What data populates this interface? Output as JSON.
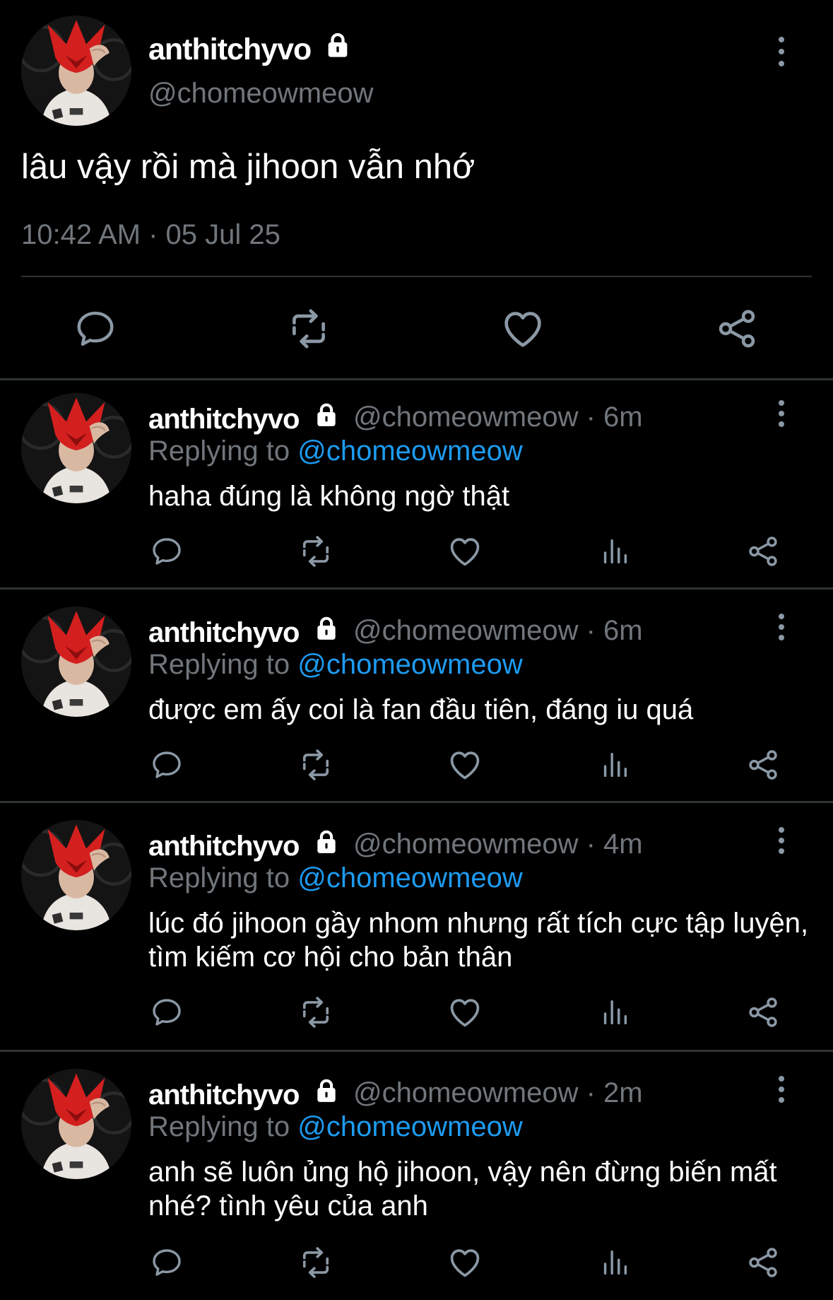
{
  "main_tweet": {
    "display_name": "anthitchyvo",
    "handle": "@chomeowmeow",
    "text": "lâu vậy rồi mà jihoon vẫn nhớ",
    "timestamp": "10:42 AM · 05 Jul 25",
    "actions": [
      "reply-icon",
      "retweet-icon",
      "like-icon",
      "share-icon"
    ]
  },
  "replies": [
    {
      "display_name": "anthitchyvo",
      "meta": "@chomeowmeow · 6m",
      "replying_prefix": "Replying to ",
      "replying_to": "@chomeowmeow",
      "text": "haha đúng là không ngờ thật"
    },
    {
      "display_name": "anthitchyvo",
      "meta": "@chomeowmeow · 6m",
      "replying_prefix": "Replying to ",
      "replying_to": "@chomeowmeow",
      "text": "được em ấy coi là fan đầu tiên, đáng iu quá"
    },
    {
      "display_name": "anthitchyvo",
      "meta": "@chomeowmeow · 4m",
      "replying_prefix": "Replying to ",
      "replying_to": "@chomeowmeow",
      "text": "lúc đó jihoon gầy nhom nhưng rất tích cực tập luyện, tìm kiếm cơ hội cho bản thân"
    },
    {
      "display_name": "anthitchyvo",
      "meta": "@chomeowmeow · 2m",
      "replying_prefix": "Replying to ",
      "replying_to": "@chomeowmeow",
      "text": "anh sẽ luôn ủng hộ jihoon, vậy nên đừng biến mất nhé? tình yêu của anh"
    }
  ],
  "reply_actions": [
    "reply-icon",
    "retweet-icon",
    "like-icon",
    "views-icon",
    "share-icon"
  ],
  "colors": {
    "background": "#000000",
    "text": "#ffffff",
    "secondary": "#71767b",
    "accent": "#1d9bf0",
    "icon": "#8b98a5",
    "divider": "#2f3336"
  }
}
